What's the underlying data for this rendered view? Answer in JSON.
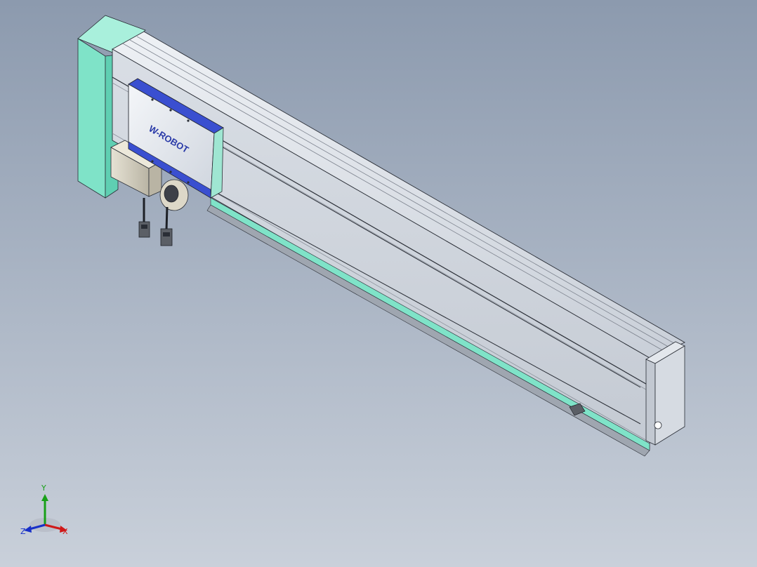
{
  "viewport": {
    "background_top": "#8c9aae",
    "background_bottom": "#c9d0da"
  },
  "model": {
    "carriage_logo_text": "W-ROBOT",
    "colors": {
      "frame": "#d6dbe2",
      "frame_shadow": "#b4bac4",
      "end_cap_teal": "#7fe3c8",
      "carriage_accent": "#3a4fd0",
      "motor": "#d9d4c4",
      "edge": "#2a2e36"
    }
  },
  "triad": {
    "x_label": "X",
    "y_label": "Y",
    "z_label": "Z",
    "x_color": "#d01818",
    "y_color": "#18a018",
    "z_color": "#1830c8"
  }
}
